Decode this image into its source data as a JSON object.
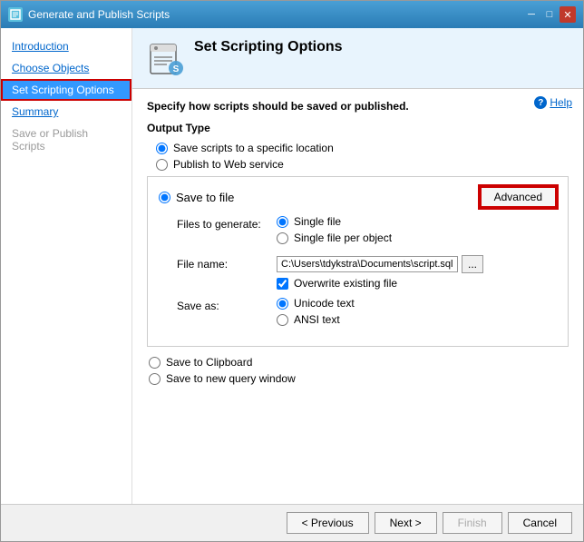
{
  "window": {
    "title": "Generate and Publish Scripts",
    "icon": "script-icon"
  },
  "titlebar": {
    "minimize_label": "─",
    "maximize_label": "□",
    "close_label": "✕"
  },
  "sidebar": {
    "items": [
      {
        "id": "introduction",
        "label": "Introduction",
        "state": "link"
      },
      {
        "id": "choose-objects",
        "label": "Choose Objects",
        "state": "link"
      },
      {
        "id": "set-scripting-options",
        "label": "Set Scripting Options",
        "state": "active"
      },
      {
        "id": "summary",
        "label": "Summary",
        "state": "link"
      },
      {
        "id": "save-publish",
        "label": "Save or Publish Scripts",
        "state": "disabled"
      }
    ]
  },
  "header": {
    "title": "Set Scripting Options",
    "icon_alt": "scripting-icon"
  },
  "help": {
    "label": "Help"
  },
  "main": {
    "instruction": "Specify how scripts should be saved or published.",
    "output_type_label": "Output Type",
    "output_type_options": [
      {
        "id": "save-specific",
        "label": "Save scripts to a specific location",
        "checked": true
      },
      {
        "id": "publish-web",
        "label": "Publish to Web service",
        "checked": false
      }
    ],
    "save_to_file": {
      "label": "Save to file",
      "checked": true,
      "advanced_btn_label": "Advanced",
      "files_to_generate_label": "Files to generate:",
      "files_options": [
        {
          "id": "single-file",
          "label": "Single file",
          "checked": true
        },
        {
          "id": "single-file-per-object",
          "label": "Single file per object",
          "checked": false
        }
      ],
      "file_name_label": "File name:",
      "file_name_value": "C:\\Users\\tdykstra\\Documents\\script.sql",
      "browse_btn_label": "...",
      "overwrite_label": "Overwrite existing file",
      "overwrite_checked": true,
      "save_as_label": "Save as:",
      "save_as_options": [
        {
          "id": "unicode",
          "label": "Unicode text",
          "checked": true
        },
        {
          "id": "ansi",
          "label": "ANSI text",
          "checked": false
        }
      ]
    },
    "save_clipboard": {
      "label": "Save to Clipboard",
      "checked": false
    },
    "save_query_window": {
      "label": "Save to new query window",
      "checked": false
    }
  },
  "footer": {
    "prev_label": "< Previous",
    "next_label": "Next >",
    "finish_label": "Finish",
    "cancel_label": "Cancel"
  }
}
